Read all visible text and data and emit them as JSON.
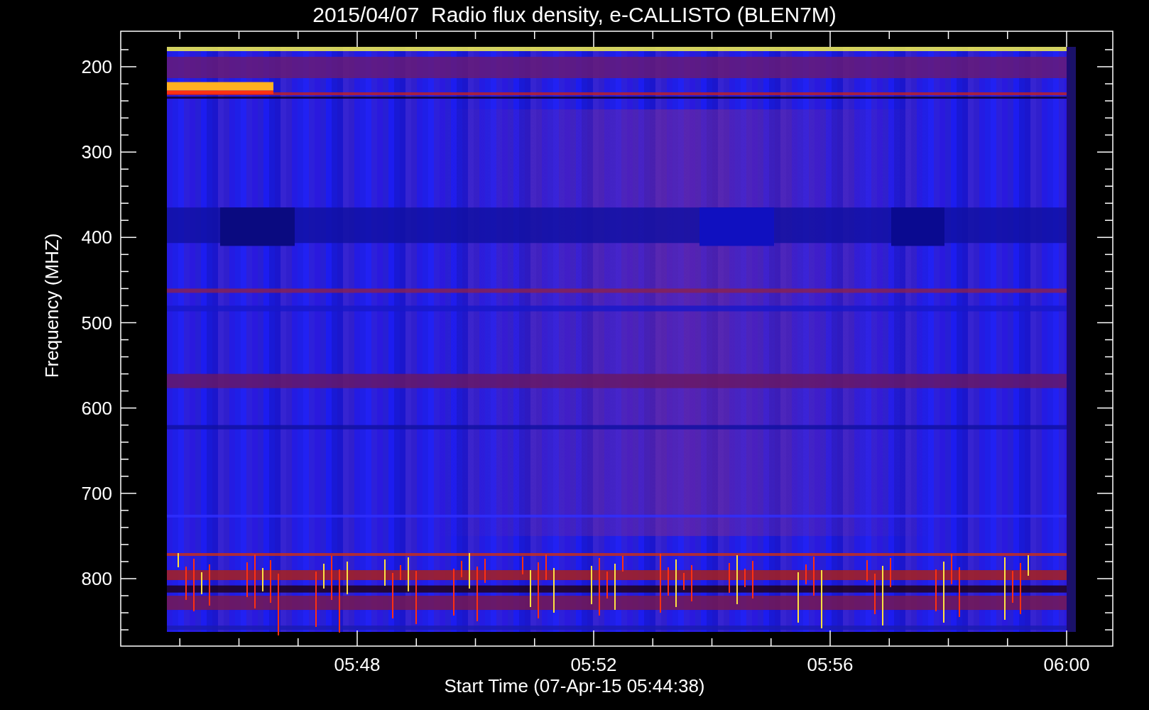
{
  "title": "2015/04/07  Radio flux density, e-CALLISTO (BLEN7M)",
  "y_axis": {
    "label": "Frequency (MHZ)",
    "ticks": [
      "200",
      "300",
      "400",
      "500",
      "600",
      "700",
      "800"
    ]
  },
  "x_axis": {
    "label": "Start Time (07-Apr-15 05:44:38)",
    "ticks": [
      "05:48",
      "05:52",
      "05:56",
      "06:00"
    ]
  }
}
